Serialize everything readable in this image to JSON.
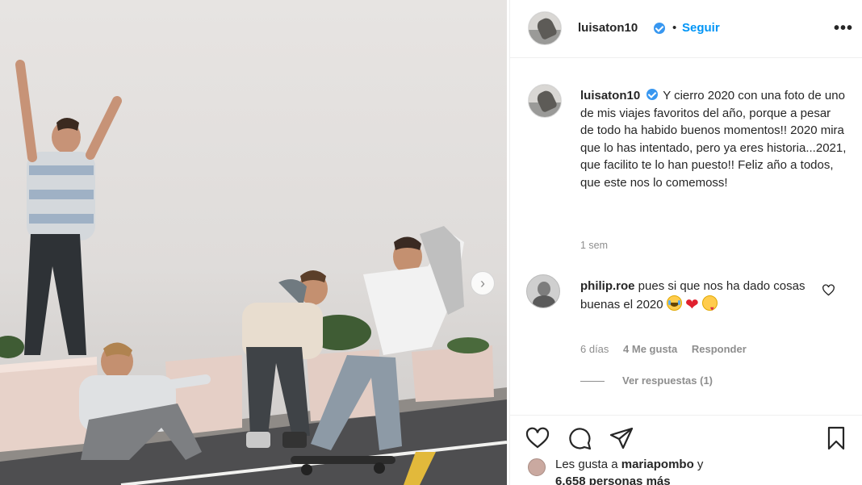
{
  "post": {
    "username": "luisaton10",
    "follow_label": "Seguir",
    "separator": "•",
    "more_label": "•••"
  },
  "caption": {
    "username": "luisaton10",
    "text": "Y cierro 2020 con una foto de uno de mis viajes favoritos del año, porque a pesar de todo ha habido buenos momentos!! 2020 mira que lo has intentado, pero ya eres historia...2021, que facilito te lo han puesto!! Feliz año a todos, que este nos lo comemoss!",
    "time": "1 sem"
  },
  "comment": {
    "username": "philip.roe",
    "text": "pues si que nos ha dado cosas buenas el 2020",
    "time": "6 días",
    "likes": "4 Me gusta",
    "reply_label": "Responder",
    "view_replies": "Ver respuestas (1)"
  },
  "likes": {
    "prefix": "Les gusta a",
    "user": "mariapombo",
    "suffix": "y",
    "count": "6.658 personas más"
  },
  "colors": {
    "accent": "#0095f6",
    "verified": "#3897f0",
    "muted": "#8e8e8e",
    "heart": "#e0202e"
  },
  "icons": [
    "chevron-right-icon",
    "verified-icon",
    "more-icon",
    "heart-icon",
    "comment-icon",
    "share-icon",
    "bookmark-icon"
  ]
}
